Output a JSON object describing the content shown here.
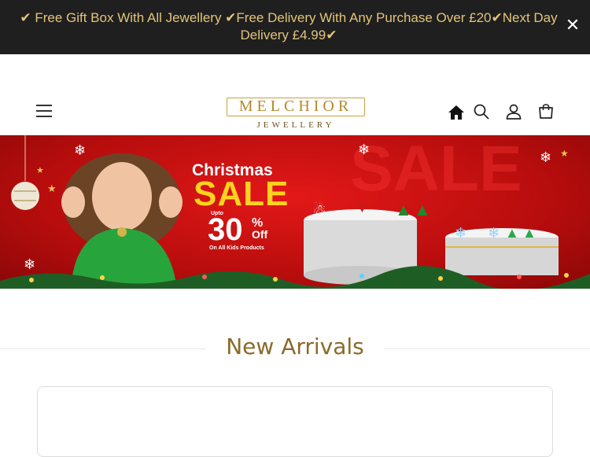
{
  "announcement": {
    "text": "✔ Free Gift Box With All Jewellery ✔Free Delivery With Any Purchase Over £20✔Next Day Delivery £4.99✔",
    "close_icon": "close-icon"
  },
  "header": {
    "menu_icon": "hamburger-menu-icon",
    "logo": {
      "brand": "MELCHIOR",
      "sub": "JEWELLERY"
    },
    "icons": [
      "home-icon",
      "search-icon",
      "account-icon",
      "cart-icon"
    ]
  },
  "banner": {
    "title_line1": "Christmas",
    "title_line2": "SALE",
    "upto": "Upto",
    "percent": "30",
    "percent_sign": "%",
    "off": "Off",
    "subtitle": "On All Kids Products",
    "bg_word": "SALE"
  },
  "section": {
    "title": "New Arrivals"
  },
  "colors": {
    "announce_bg": "#1f1f1f",
    "announce_text": "#e3c47a",
    "gold": "#b38a2a",
    "banner_red": "#d81414",
    "sale_yellow": "#ffd21f"
  }
}
